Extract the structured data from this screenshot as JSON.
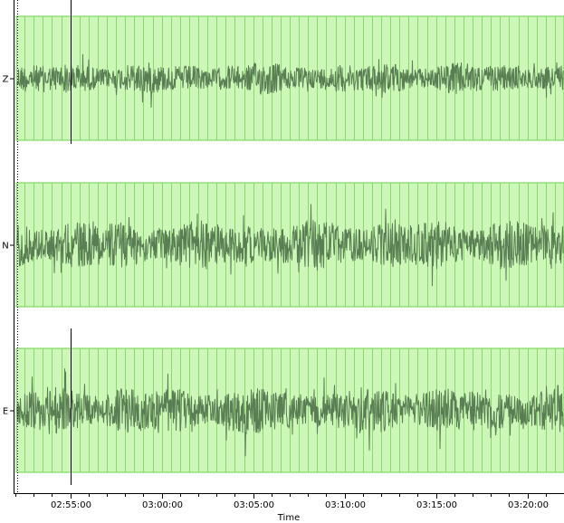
{
  "chart_data": {
    "type": "line",
    "title": "",
    "xlabel": "Time",
    "ylabel": "",
    "x_tick_labels": [
      "02:55:00",
      "03:00:00",
      "03:05:00",
      "03:10:00",
      "03:15:00",
      "03:20:00"
    ],
    "x_tick_minutes": [
      0,
      5,
      10,
      15,
      20,
      25
    ],
    "x_range_minutes": [
      -3.1,
      27.0
    ],
    "grid": true,
    "traces": [
      {
        "label": "Z",
        "amplitude": 0.25,
        "spike_minute": 0.0
      },
      {
        "label": "N",
        "amplitude": 0.4,
        "spike_minute": null
      },
      {
        "label": "E",
        "amplitude": 0.38,
        "spike_minute": 0.0
      }
    ]
  },
  "colors": {
    "band_fill": "#ccf7b9",
    "band_stroke": "#6dd04a",
    "grid_line": "#8ad86a",
    "waveform": "#5a7e54",
    "axis": "#000000"
  }
}
